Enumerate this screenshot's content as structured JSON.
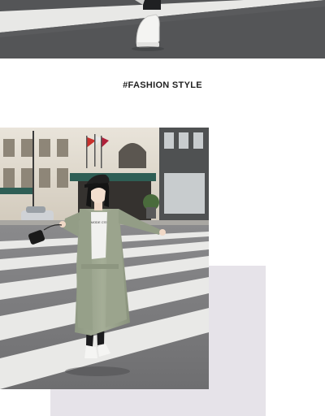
{
  "heading": {
    "text": "#FASHION STYLE"
  },
  "top_photo": {
    "description_icon": "street-photo",
    "tones": {
      "asphalt": "#545557",
      "stripe": "#e8e8e6"
    }
  },
  "main_photo": {
    "description_icon": "street-photo",
    "shirt_print": "LA MODE C'EST",
    "shop_sign": "",
    "tones": {
      "asphalt": "#7c7c7e",
      "stripe": "#e9e9e7",
      "building": "#cfc7b8",
      "coat": "#9aa48c",
      "awning": "#2e5e55"
    }
  },
  "deco_block": {
    "color": "#e6e3e9"
  }
}
